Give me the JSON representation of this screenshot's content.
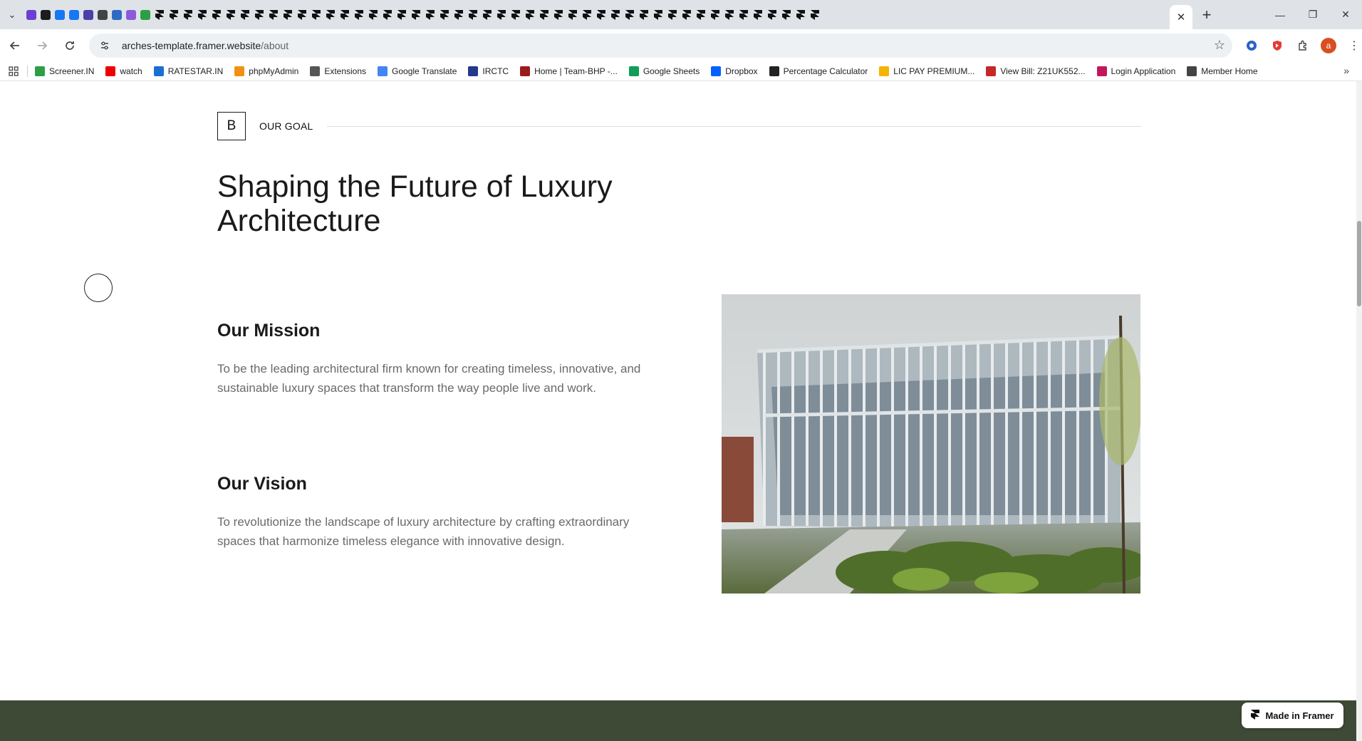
{
  "browser": {
    "active_tab_close": "✕",
    "new_tab": "+",
    "url_host": "arches-template.framer.website",
    "url_path": "/about",
    "window_controls": {
      "minimize": "—",
      "restore": "❐",
      "close": "✕"
    }
  },
  "bookmarks": [
    {
      "label": "Screener.IN",
      "color": "#2e9e44"
    },
    {
      "label": "watch",
      "color": "#e00"
    },
    {
      "label": "RATESTAR.IN",
      "color": "#1b6fd1"
    },
    {
      "label": "phpMyAdmin",
      "color": "#f29111"
    },
    {
      "label": "Extensions",
      "color": "#555"
    },
    {
      "label": "Google Translate",
      "color": "#4285f4"
    },
    {
      "label": "IRCTC",
      "color": "#223a8c"
    },
    {
      "label": "Home | Team-BHP -...",
      "color": "#9b1b1b"
    },
    {
      "label": "Google Sheets",
      "color": "#0f9d58"
    },
    {
      "label": "Dropbox",
      "color": "#0061ff"
    },
    {
      "label": "Percentage Calculator",
      "color": "#222"
    },
    {
      "label": "LIC PAY PREMIUM...",
      "color": "#f4b400"
    },
    {
      "label": "View Bill: Z21UK552...",
      "color": "#c62828"
    },
    {
      "label": "Login Application",
      "color": "#c2185b"
    },
    {
      "label": "Member Home",
      "color": "#444"
    }
  ],
  "page": {
    "goal_badge": "B",
    "goal_label": "OUR GOAL",
    "headline": "Shaping the Future of Luxury Architecture",
    "mission_title": "Our Mission",
    "mission_text": "To be the leading architectural firm known for creating timeless, innovative, and sustainable luxury spaces that transform the way people live and work.",
    "vision_title": "Our Vision",
    "vision_text": "To revolutionize the landscape of luxury architecture by crafting extraordinary spaces that harmonize timeless elegance with innovative design.",
    "framer_badge": "Made in Framer"
  },
  "colors": {
    "footer_band": "#3e4a35",
    "tabstrip": "#dfe3e8"
  }
}
